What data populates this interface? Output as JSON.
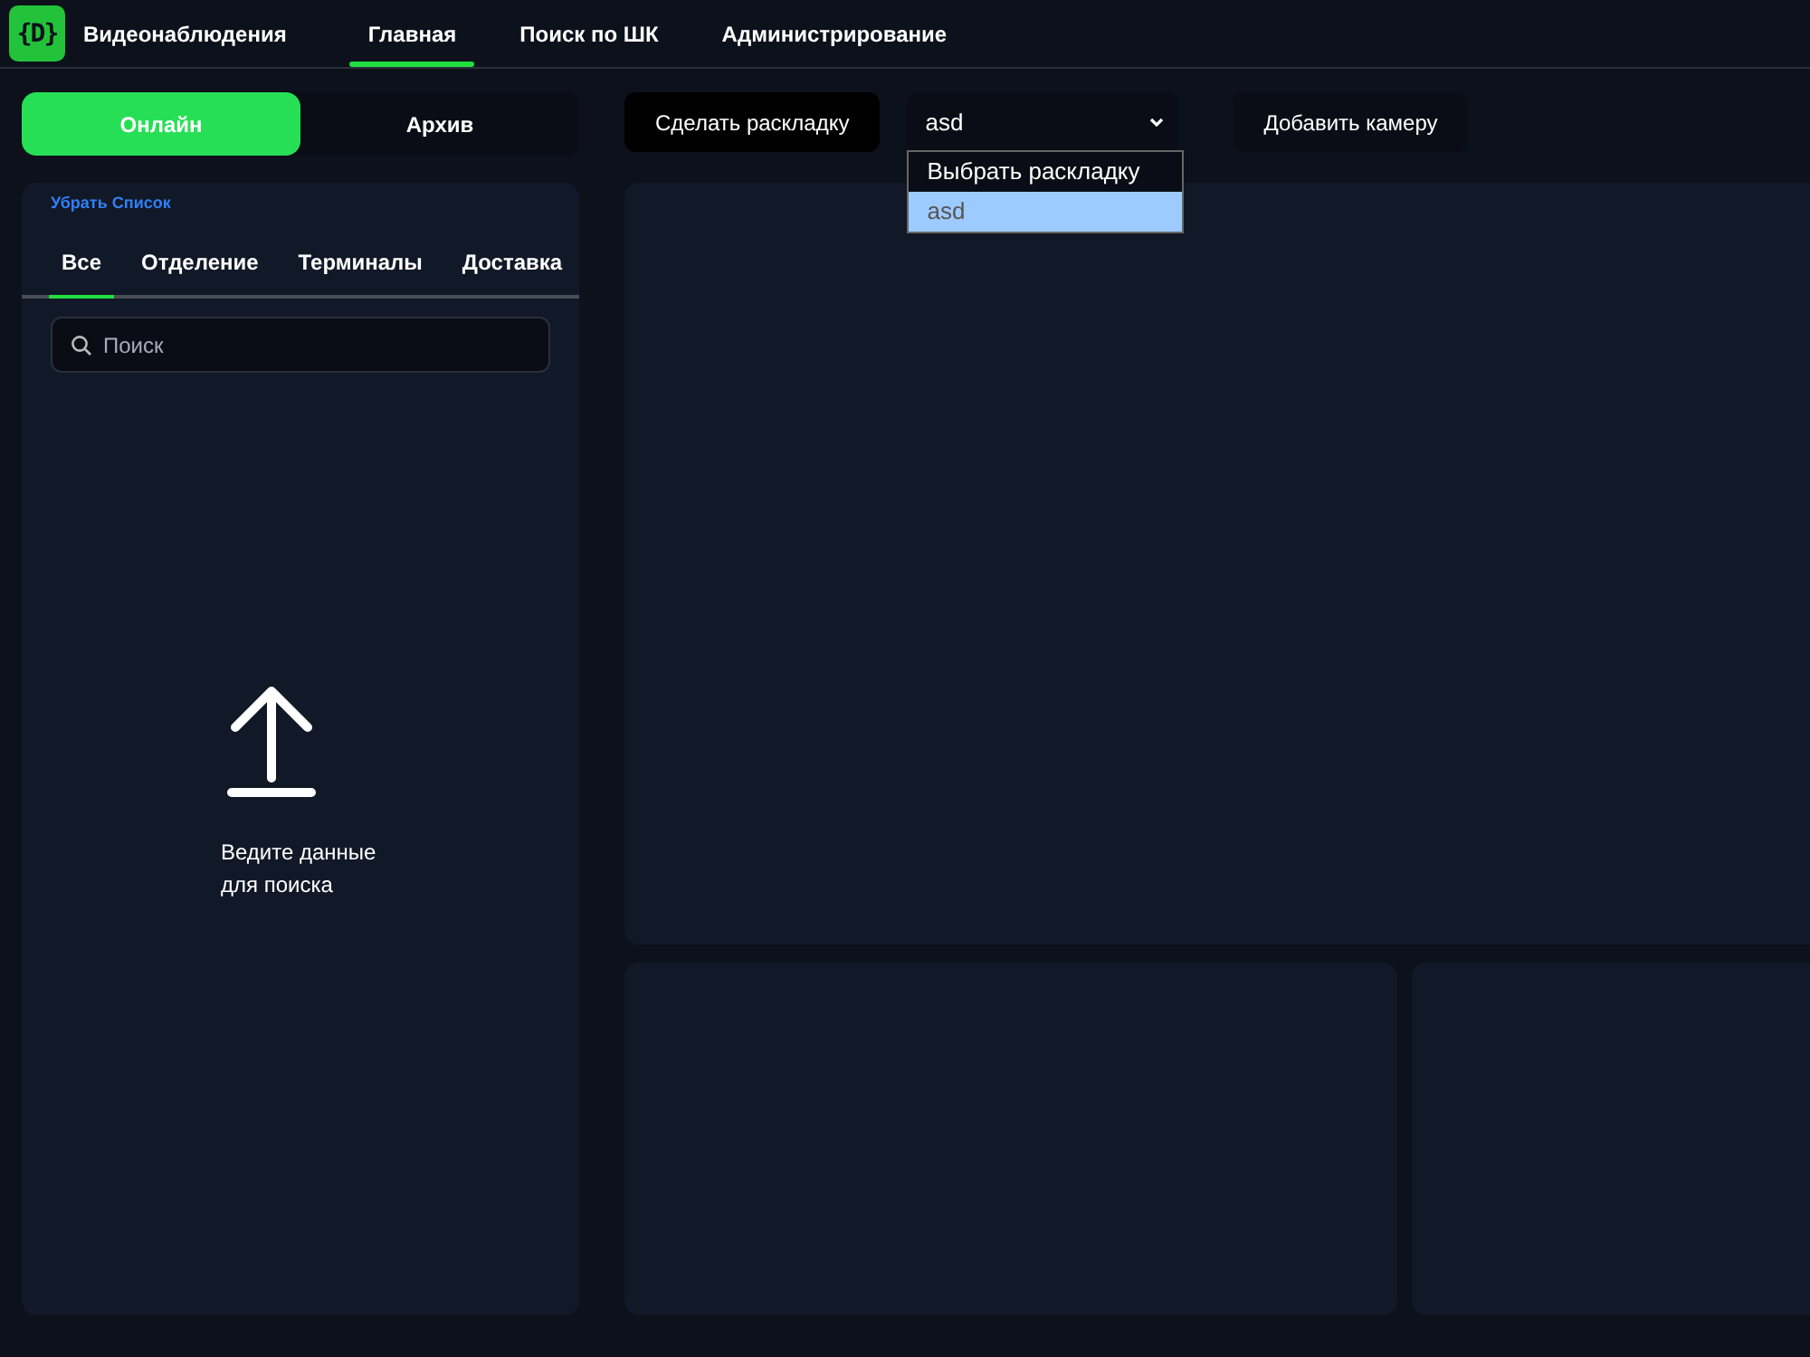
{
  "header": {
    "logo": "{D}",
    "brand": "Видеонаблюдения",
    "nav": [
      {
        "label": "Главная",
        "selected": true
      },
      {
        "label": "Поиск по ШК",
        "selected": false
      },
      {
        "label": "Администрирование",
        "selected": false
      }
    ]
  },
  "mode_tabs": [
    {
      "label": "Онлайн",
      "selected": true
    },
    {
      "label": "Архив",
      "selected": false
    }
  ],
  "sidebar": {
    "hide_link": "Убрать Список",
    "tabs": [
      {
        "label": "Все",
        "selected": true
      },
      {
        "label": "Отделение",
        "selected": false
      },
      {
        "label": "Терминалы",
        "selected": false
      },
      {
        "label": "Доставка",
        "selected": false
      }
    ],
    "search": {
      "placeholder": "Поиск"
    },
    "empty_message": "Ведите данные для поиска"
  },
  "toolbar": {
    "make_layout_button": "Сделать раскладку",
    "layout_select": {
      "value": "asd",
      "expanded": true,
      "options": [
        {
          "label": "Выбрать раскладку",
          "selected": false
        },
        {
          "label": "asd",
          "selected": true
        }
      ]
    },
    "add_camera_button": "Добавить камеру"
  },
  "camera_panels": [
    {
      "kind": "large"
    },
    {
      "kind": "small"
    },
    {
      "kind": "small"
    }
  ]
}
